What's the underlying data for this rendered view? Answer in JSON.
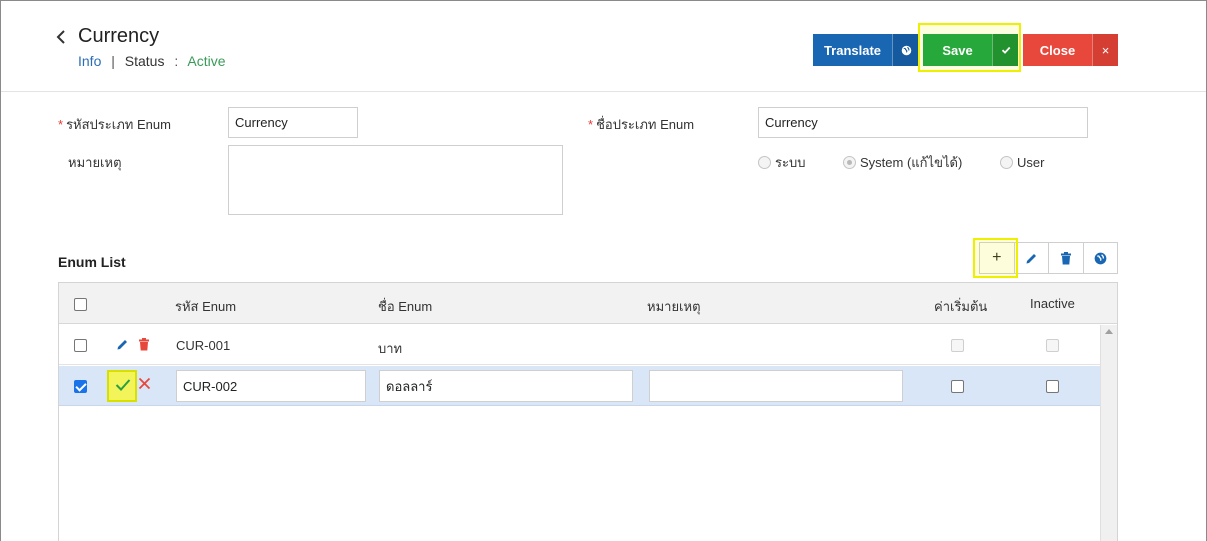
{
  "header": {
    "title": "Currency",
    "subnav": {
      "info": "Info",
      "separator": "|",
      "status_label": "Status",
      "colon": ":",
      "status_value": "Active"
    },
    "buttons": {
      "translate": "Translate",
      "save": "Save",
      "close": "Close",
      "close_x": "×"
    }
  },
  "form": {
    "enum_code_label": "รหัสประเภท Enum",
    "enum_code_value": "Currency",
    "enum_name_label": "ชื่อประเภท Enum",
    "enum_name_value": "Currency",
    "remark_label": "หมายเหตุ",
    "remark_value": "",
    "required_mark": "*",
    "radio_options": [
      {
        "label": "ระบบ",
        "checked": false
      },
      {
        "label": "System (แก้ไขได้)",
        "checked": true
      },
      {
        "label": "User",
        "checked": false
      }
    ]
  },
  "enum_list": {
    "title": "Enum List",
    "toolbar": {
      "add": "+"
    },
    "columns": {
      "code": "รหัส Enum",
      "name": "ชื่อ Enum",
      "remark": "หมายเหตุ",
      "default": "ค่าเริ่มต้น",
      "inactive": "Inactive"
    },
    "rows": [
      {
        "code": "CUR-001",
        "name": "บาท",
        "remark": "",
        "default": false,
        "inactive": false,
        "selected": false
      },
      {
        "code": "CUR-002",
        "name": "ดอลลาร์",
        "remark": "",
        "default": false,
        "inactive": false,
        "selected": true
      }
    ]
  },
  "colors": {
    "translate": "#1966b3",
    "save": "#27a83b",
    "close": "#e8483c",
    "highlight": "#eef000",
    "selected_row": "#d9e6f7",
    "status_active": "#3a9b58",
    "link": "#2d6db5"
  }
}
